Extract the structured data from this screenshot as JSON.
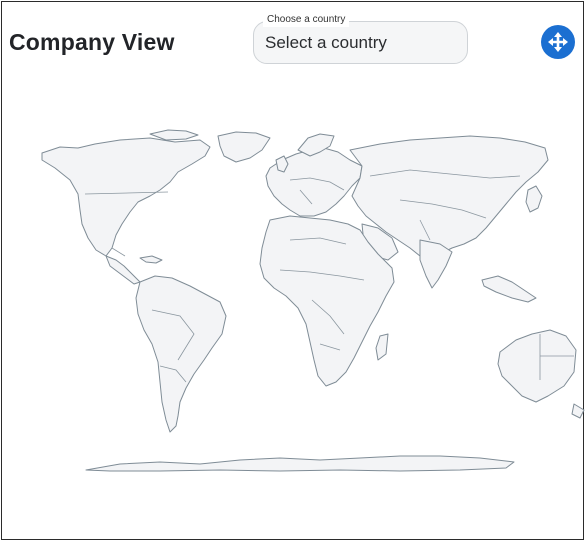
{
  "header": {
    "title": "Company View"
  },
  "country_select": {
    "label": "Choose a country",
    "placeholder": "Select a country",
    "value": "Select a country"
  },
  "controls": {
    "move_icon": "move-arrows-icon",
    "accent_color": "#1b6fd1"
  },
  "map": {
    "fill_color": "#f3f4f6",
    "border_color": "#7f8c96"
  }
}
